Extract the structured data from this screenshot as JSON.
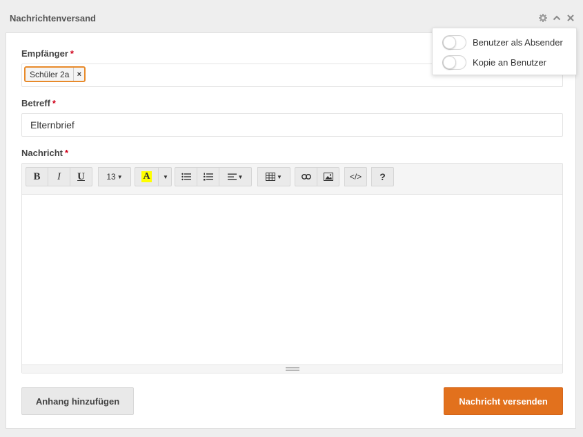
{
  "panel": {
    "title": "Nachrichtenversand"
  },
  "form": {
    "recipients_label": "Empfänger",
    "recipients": [
      {
        "label": "Schüler 2a",
        "remove": "×"
      }
    ],
    "subject_label": "Betreff",
    "subject_value": "Elternbrief",
    "message_label": "Nachricht",
    "required_mark": "*"
  },
  "toolbar": {
    "bold": "B",
    "italic": "I",
    "underline": "U",
    "font_size": "13",
    "highlight": "A",
    "help": "?",
    "code": "</>"
  },
  "buttons": {
    "attach": "Anhang hinzufügen",
    "send": "Nachricht versenden"
  },
  "options": {
    "sender_as_user": "Benutzer als Absender",
    "copy_to_user": "Kopie an Benutzer",
    "sender_as_user_on": false,
    "copy_to_user_on": false
  },
  "colors": {
    "accent": "#e2711d",
    "tag_border": "#e88a2a",
    "required": "#d0021b"
  }
}
